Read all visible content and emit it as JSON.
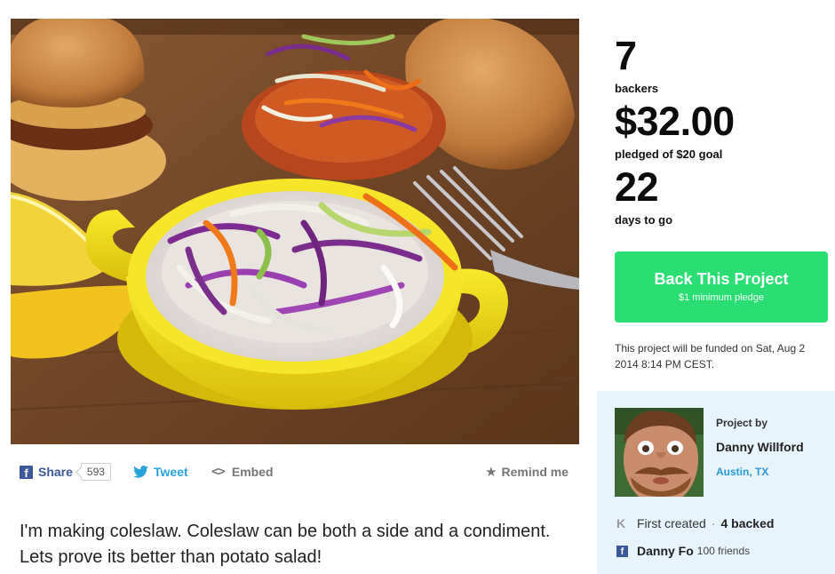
{
  "stats": {
    "backers_count": "7",
    "backers_label": "backers",
    "pledged_amount": "$32.00",
    "pledged_label": "pledged of $20 goal",
    "days_count": "22",
    "days_label": "days to go"
  },
  "back_button": {
    "title": "Back This Project",
    "subtitle": "$1 minimum pledge"
  },
  "funding_note": "This project will be funded on Sat, Aug 2 2014 8:14 PM CEST.",
  "share_bar": {
    "share_label": "Share",
    "share_count": "593",
    "tweet_label": "Tweet",
    "embed_label": "Embed",
    "remind_label": "Remind me"
  },
  "description": "I'm making coleslaw. Coleslaw can be both a side and a condiment. Lets prove its better than potato salad!",
  "creator": {
    "project_by_label": "Project by",
    "name": "Danny Willford",
    "location": "Austin, TX",
    "first_created": "First created",
    "backed": "4 backed",
    "fb_name": "Danny Fo",
    "fb_friends": "100 friends"
  },
  "icons": {
    "facebook": "facebook-icon",
    "twitter": "twitter-icon",
    "embed": "code-icon",
    "remind": "star-icon",
    "kickstarter": "kickstarter-k-icon"
  },
  "colors": {
    "back_button": "#2bde73",
    "creator_card": "#e7f4fc",
    "facebook": "#3b5998",
    "twitter": "#2aa3dd",
    "location_link": "#2a9bd6"
  }
}
